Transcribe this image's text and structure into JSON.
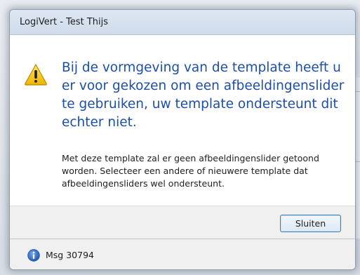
{
  "dialog": {
    "title": "LogiVert - Test Thijs",
    "main_instruction": "Bij de vormgeving van de template heeft u er voor gekozen om een afbeeldingenslider te gebruiken, uw template ondersteunt dit echter niet.",
    "detail": "Met deze template zal er geen afbeeldingenslider getoond worden. Selecteer een andere of nieuwere template dat afbeeldingensliders wel ondersteunt.",
    "close_button_label": "Sluiten",
    "footer_text": "Msg 30794",
    "icons": {
      "main": "warning-icon",
      "footer": "info-icon"
    }
  },
  "colors": {
    "instruction_text": "#1b4fa8",
    "warning_yellow": "#f5c400",
    "info_blue": "#2f6bc8"
  }
}
